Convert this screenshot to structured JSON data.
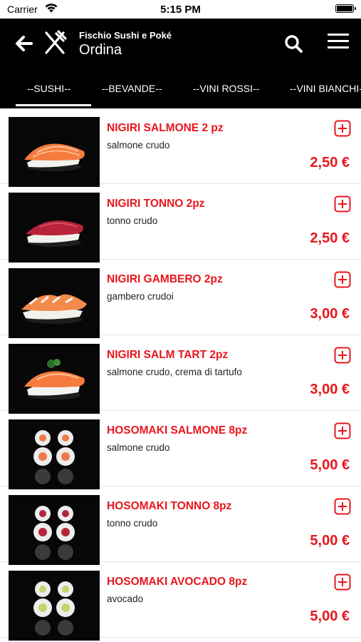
{
  "status_bar": {
    "carrier": "Carrier",
    "time": "5:15 PM"
  },
  "header": {
    "app_name": "Fischio Sushi e Poké",
    "title": "Ordina"
  },
  "icons": {
    "back": "arrow-left-icon",
    "logo": "fork-knife-icon",
    "search": "search-icon",
    "menu": "hamburger-menu-icon",
    "add": "plus-square-icon"
  },
  "colors": {
    "accent": "#e8161c",
    "header_bg": "#000000"
  },
  "tabs": [
    {
      "label": "--SUSHI--",
      "selected": true
    },
    {
      "label": "--BEVANDE--"
    },
    {
      "label": "--VINI ROSSI--"
    },
    {
      "label": "--VINI BIANCHI--"
    }
  ],
  "products": [
    {
      "name": "NIGIRI SALMONE 2 pz",
      "description": "salmone crudo",
      "price": "2,50 €"
    },
    {
      "name": "NIGIRI TONNO 2pz",
      "description": "tonno crudo",
      "price": "2,50 €"
    },
    {
      "name": "NIGIRI GAMBERO 2pz",
      "description": "gambero crudoi",
      "price": "3,00 €"
    },
    {
      "name": "NIGIRI SALM TART 2pz",
      "description": "salmone crudo, crema di tartufo",
      "price": "3,00 €"
    },
    {
      "name": "HOSOMAKI SALMONE 8pz",
      "description": "salmone crudo",
      "price": "5,00 €"
    },
    {
      "name": "HOSOMAKI TONNO 8pz",
      "description": "tonno crudo",
      "price": "5,00 €"
    },
    {
      "name": "HOSOMAKI AVOCADO 8pz",
      "description": "avocado",
      "price": "5,00 €"
    }
  ]
}
